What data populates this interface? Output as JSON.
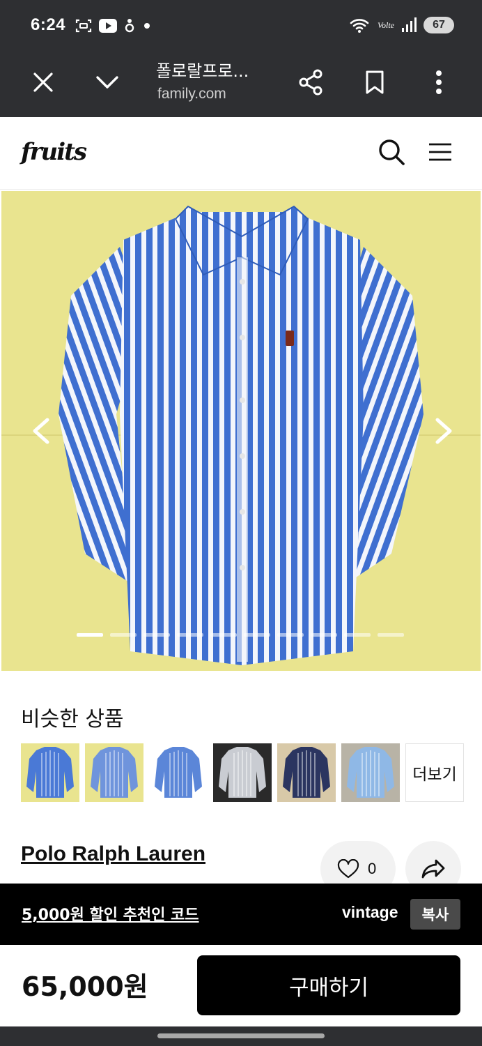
{
  "status_bar": {
    "time": "6:24",
    "battery": "67",
    "network": "Volte",
    "icons": [
      "screenshot-icon",
      "youtube-icon",
      "notification-icon",
      "dot-icon",
      "wifi-icon",
      "signal-icon"
    ]
  },
  "browser": {
    "title": "폴로랄프로...",
    "url": "family.com",
    "icons": [
      "close-icon",
      "chevron-down-icon",
      "share-icon",
      "bookmark-icon",
      "more-vertical-icon"
    ]
  },
  "site": {
    "logo": "fruits",
    "icons": [
      "search-icon",
      "menu-icon"
    ]
  },
  "gallery": {
    "slide_count": 10,
    "current_index": 0,
    "colors": {
      "background": "#e9e48f",
      "stripe_blue": "#3f6fd0",
      "stripe_white": "#f4f6fb"
    }
  },
  "similar": {
    "title": "비슷한 상품",
    "more_label": "더보기",
    "thumbnails": [
      {
        "name": "thumb-blue-stripe-shirt-1",
        "bg": "#e9e48f",
        "shirt": "#4a79d6"
      },
      {
        "name": "thumb-blue-stripe-shirt-2",
        "bg": "#e9e48f",
        "shirt": "#6f94dc"
      },
      {
        "name": "thumb-light-blue-shirt",
        "bg": "#ffffff",
        "shirt": "#5b86d8"
      },
      {
        "name": "thumb-gray-stripe-shirt",
        "bg": "#2a2a2a",
        "shirt": "#c9ccd2"
      },
      {
        "name": "thumb-navy-stripe-shirt",
        "bg": "#d8c9a8",
        "shirt": "#2b3560"
      },
      {
        "name": "thumb-sky-blue-shirt",
        "bg": "#b8b3a6",
        "shirt": "#8fb8e6"
      }
    ]
  },
  "product": {
    "brand": "Polo Ralph Lauren",
    "like_count": "0",
    "price": "65,000원",
    "buy_label": "구매하기"
  },
  "promo": {
    "text": "5,000원 할인 추천인 코드",
    "code": "vintage",
    "copy_label": "복사"
  }
}
